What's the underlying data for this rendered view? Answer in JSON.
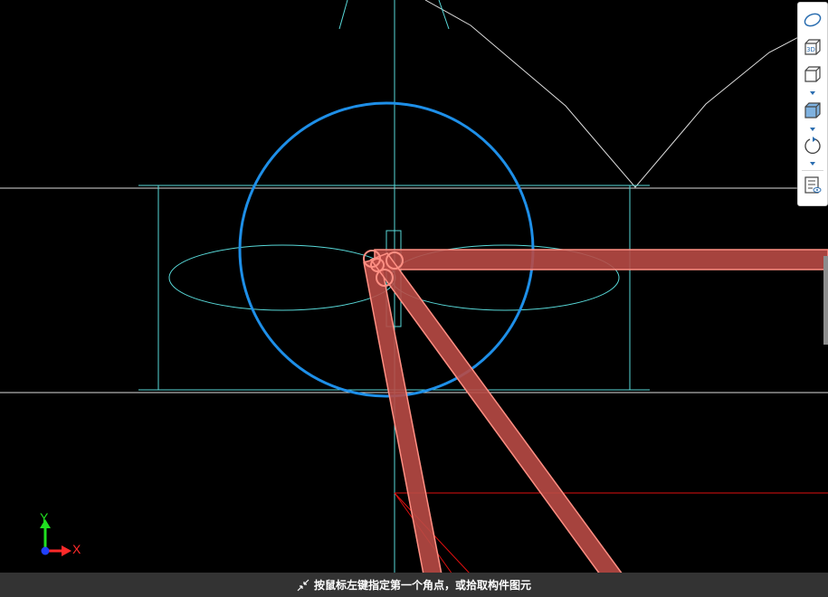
{
  "status_bar": {
    "prompt": "按鼠标左键指定第一个角点，或拾取构件图元",
    "icon": "pick-cursor-icon"
  },
  "axis_indicator": {
    "x_label": "X",
    "y_label": "Y",
    "x_color": "#ff2a2a",
    "y_color": "#20e020",
    "origin_color": "#2040ff"
  },
  "view_toolbar": {
    "buttons": [
      {
        "name": "ellipse-view-icon"
      },
      {
        "name": "3d-view-icon",
        "label": "3D"
      },
      {
        "name": "cube-outline-icon"
      },
      {
        "name": "cube-shaded-icon"
      },
      {
        "name": "rotate-icon"
      },
      {
        "name": "layer-display-icon"
      }
    ]
  },
  "colors": {
    "background": "#000000",
    "cyan_lines": "#58d9d9",
    "white_lines": "#dcdcdc",
    "circle": "#1e8fe8",
    "beam_fill": "#b84a45",
    "beam_edge": "#ff8f83",
    "red_lines": "#e01010"
  }
}
